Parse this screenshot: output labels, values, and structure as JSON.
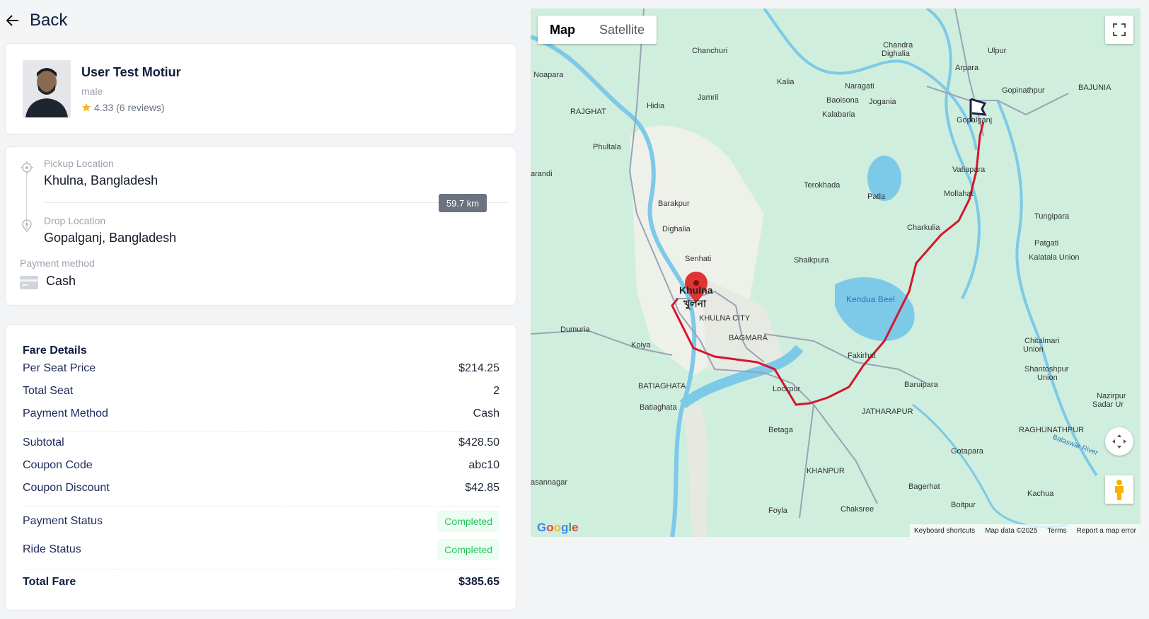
{
  "nav": {
    "back_label": "Back"
  },
  "user": {
    "name": "User Test Motiur",
    "gender": "male",
    "rating": "4.33 (6 reviews)"
  },
  "route": {
    "pickup_label": "Pickup Location",
    "pickup_value": "Khulna, Bangladesh",
    "drop_label": "Drop Location",
    "drop_value": "Gopalganj, Bangladesh",
    "distance": "59.7 km",
    "payment_label": "Payment method",
    "payment_value": "Cash"
  },
  "fare": {
    "title": "Fare Details",
    "rows": [
      {
        "label": "Per Seat Price",
        "value": "$214.25"
      },
      {
        "label": "Total Seat",
        "value": "2"
      },
      {
        "label": "Payment Method",
        "value": "Cash"
      },
      {
        "label": "Subtotal",
        "value": "$428.50"
      },
      {
        "label": "Coupon Code",
        "value": "abc10"
      },
      {
        "label": "Coupon Discount",
        "value": "$42.85"
      }
    ],
    "payment_status_label": "Payment Status",
    "payment_status": "Completed",
    "ride_status_label": "Ride Status",
    "ride_status": "Completed",
    "total_label": "Total Fare",
    "total_value": "$385.65"
  },
  "map": {
    "tabs": [
      "Map",
      "Satellite"
    ],
    "active_tab": "Map",
    "google": "Google",
    "footer": [
      "Keyboard shortcuts",
      "Map data ©2025",
      "Terms",
      "Report a map error"
    ],
    "places": {
      "khulna": "Khulna",
      "khulna_bn": "খুলনা",
      "gopalganj": "Gopalganj",
      "chanchuri": "Chanchuri",
      "chandra": "Chandra",
      "dighalia": "Dighalia",
      "ulpur": "Ulpur",
      "noapara": "Noapara",
      "kalia": "Kalia",
      "naragati": "Naragati",
      "baioisona": "Baoisona",
      "jogania": "Jogania",
      "gopinathpur": "Gopinathpur",
      "bajunia": "BAJUNIA",
      "rajghat": "RAJGHAT",
      "hidia": "Hidia",
      "jamril": "Jamril",
      "arpara": "Arpara",
      "kalabaria": "Kalabaria",
      "phultala": "Phultala",
      "vatiapara": "Vatiapara",
      "terokhada": "Terokhada",
      "patla": "Patla",
      "mollahat": "Mollahat",
      "barakpur": "Barakpur",
      "tungipara": "Tungipara",
      "charkulia": "Charkulia",
      "dighalia2": "Dighalia",
      "patgati": "Patgati",
      "senhati": "Senhati",
      "shaikpura": "Shaikpura",
      "kalatala": "Kalatala Union",
      "kendua": "Kendua Beel",
      "khulna_city": "KHULNA CITY",
      "dumuria": "Dumuria",
      "koiya": "Koiya",
      "bagmara": "BAGMARA",
      "fakirhat": "Fakirhat",
      "chitalmari": "Chitalmari",
      "chitalmari2": "Union",
      "batiaghata_caps": "BATIAGHATA",
      "batiaghata": "Batiaghata",
      "lockpur": "Lockpur",
      "baruipara": "Baruipara",
      "shantoshpur": "Shantoshpur",
      "shantoshpur2": "Union",
      "jatharapur": "JATHARAPUR",
      "nazirpur": "Nazirpur",
      "sadar": "Sadar Ur",
      "betaga": "Betaga",
      "raghunathpur": "RAGHUNATHPUR",
      "gotapara": "Gotapara",
      "khanpur": "KHANPUR",
      "bagerhat": "Bagerhat",
      "kachua": "Kachua",
      "asannagar": "asannagar",
      "foyla": "Foyla",
      "chaksree": "Chaksree",
      "boitpur": "Boitpur",
      "arandi": "arandi",
      "balaswar": "Balaswar River"
    },
    "colors": {
      "route": "#d4162c",
      "water": "#7dc9e8",
      "land": "#cfeedd",
      "urban": "#eef0ea",
      "road": "#9aa3b5"
    }
  },
  "icons": {
    "back": "arrow-left-icon",
    "star": "star-icon",
    "pickup": "target-icon",
    "drop": "map-pin-icon",
    "payment": "credit-card-icon",
    "fullscreen": "fullscreen-icon",
    "camera": "camera-control-icon",
    "pegman": "pegman-icon",
    "marker": "red-marker-icon",
    "flag": "destination-flag-icon"
  }
}
